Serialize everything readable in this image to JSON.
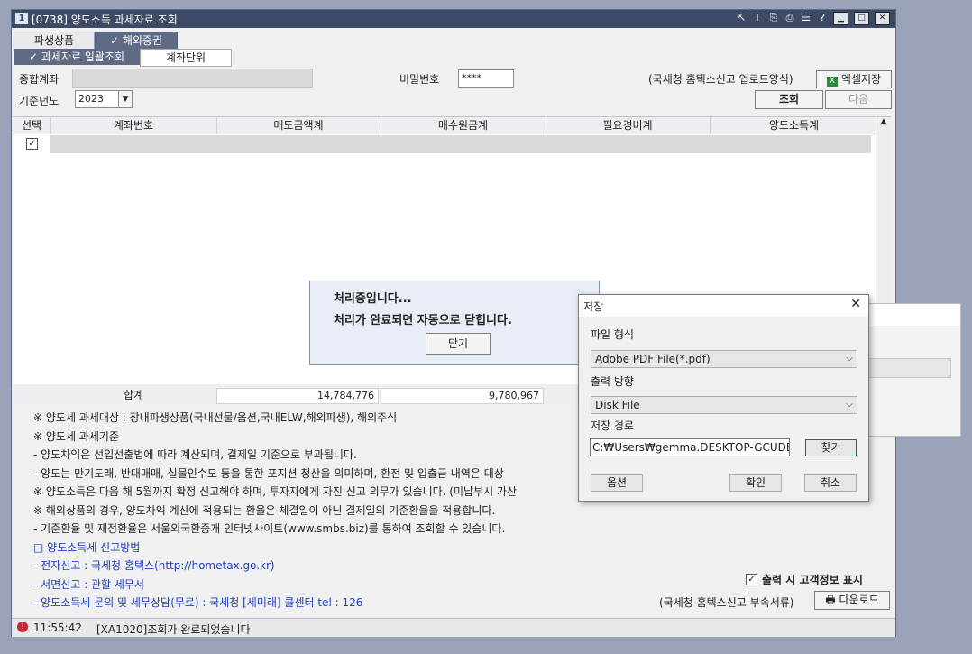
{
  "window": {
    "app_icon": "1",
    "title": "[0738] 양도소득 과세자료 조회",
    "tool_icons": [
      "⇱",
      "T",
      "⎘",
      "⎙",
      "☰",
      "?"
    ]
  },
  "tabs_top": [
    "파생상품",
    "해외증권"
  ],
  "tabs_sub": [
    "과세자료 일괄조회",
    "계좌단위"
  ],
  "form": {
    "account_label": "종합계좌",
    "password_label": "비밀번호",
    "password_value": "****",
    "year_label": "기준년도",
    "year_value": "2023",
    "export_note": "(국세청 홈텍스신고 업로드양식)",
    "excel_button": "엑셀저장",
    "query_button": "조회",
    "next_button": "다음"
  },
  "grid": {
    "headers": [
      "선택",
      "계좌번호",
      "매도금액계",
      "매수원금계",
      "필요경비계",
      "양도소득계"
    ],
    "totals_label": "합계",
    "totals": [
      "14,784,776",
      "9,780,967"
    ]
  },
  "notes": [
    "※ 양도세 과세대상 : 장내파생상품(국내선물/옵션,국내ELW,해외파생), 해외주식",
    "※ 양도세 과세기준",
    " - 양도차익은 선입선출법에 따라 계산되며, 결제일 기준으로 부과됩니다.",
    " - 양도는 만기도래, 반대매매, 실물인수도 등을 통한 포지션 청산을 의미하며, 환전 및 입출금 내역은 대상",
    "※ 양도소득은 다음 해 5월까지 확정 신고해야 하며, 투자자에게 자진 신고 의무가 있습니다. (미납부시 가산",
    "※ 해외상품의 경우, 양도차익 계산에 적용되는 환율은 체결일이 아닌 결제일의 기준환율을 적용합니다.",
    " - 기준환율 및 재정환율은 서울외국환중개 인터넷사이트(www.smbs.biz)를 통하여 조회할 수 있습니다."
  ],
  "notes_blue": [
    "□ 양도소득세 신고방법",
    " - 전자신고 : 국세청 홈텍스(http://hometax.go.kr)",
    " - 서면신고 : 관할 세무서",
    " - 양도소득세 문의 및 세무상담(무료) : 국세청 [세미래] 콜센터 tel : 126"
  ],
  "print_option": "출력 시 고객정보 표시",
  "download_note": "(국세청 홈텍스신고 부속서류)",
  "download_button": "다운로드",
  "status": {
    "time": "11:55:42",
    "message": "[XA1020]조회가 완료되었습니다"
  },
  "processing": {
    "line1": "처리중입니다...",
    "line2": "처리가 완료되면 자동으로 닫힙니다.",
    "close_button": "닫기"
  },
  "save_dialog": {
    "title": "저장",
    "format_label": "파일 형식",
    "format_value": "Adobe PDF File(*.pdf)",
    "output_label": "출력 방향",
    "output_value": "Disk File",
    "path_label": "저장 경로",
    "path_value": "C:₩Users₩gemma.DESKTOP-GCUDE",
    "browse_button": "찾기",
    "options_button": "옵션",
    "ok_button": "확인",
    "cancel_button": "취소"
  }
}
